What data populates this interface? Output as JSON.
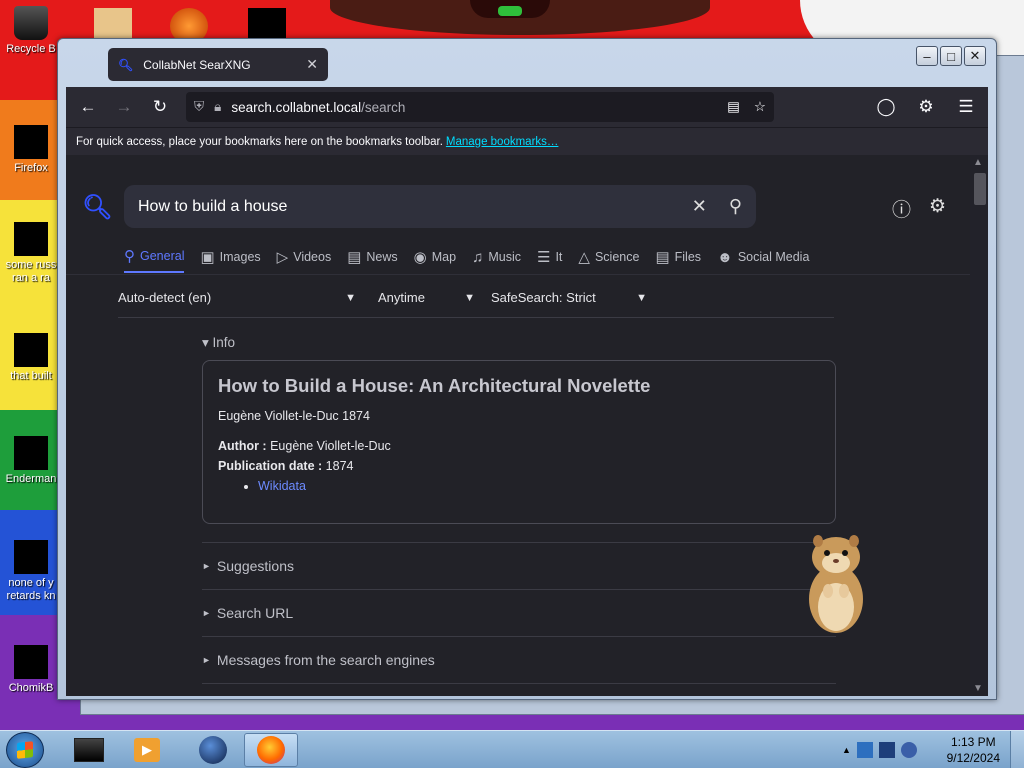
{
  "desktop": {
    "icons": [
      {
        "label": "Recycle B"
      },
      {
        "label": "Firefox"
      },
      {
        "label": "some russ\nran a ra"
      },
      {
        "label": "that built"
      },
      {
        "label": "Enderman"
      },
      {
        "label": "none of y\nretards kn"
      },
      {
        "label": "ChomikB"
      }
    ]
  },
  "window": {
    "tab": {
      "title": "CollabNet SearXNG"
    },
    "controls": {
      "minimize": "–",
      "maximize": "□",
      "close": "✕"
    }
  },
  "navbar": {
    "url_host": "search.collabnet.local",
    "url_path": "/search"
  },
  "bookmarks_bar": {
    "message": "For quick access, place your bookmarks here on the bookmarks toolbar.",
    "link": "Manage bookmarks…"
  },
  "search": {
    "query": "How to build a house"
  },
  "categories": [
    {
      "label": "General",
      "icon": "search-icon",
      "active": true
    },
    {
      "label": "Images",
      "icon": "image-icon"
    },
    {
      "label": "Videos",
      "icon": "play-icon"
    },
    {
      "label": "News",
      "icon": "newspaper-icon"
    },
    {
      "label": "Map",
      "icon": "map-pin-icon"
    },
    {
      "label": "Music",
      "icon": "music-icon"
    },
    {
      "label": "It",
      "icon": "layers-icon"
    },
    {
      "label": "Science",
      "icon": "box-icon"
    },
    {
      "label": "Files",
      "icon": "drive-icon"
    },
    {
      "label": "Social Media",
      "icon": "people-icon"
    }
  ],
  "filters": {
    "language": "Auto-detect (en)",
    "time": "Anytime",
    "safesearch": "SafeSearch: Strict"
  },
  "infobox": {
    "section_title": "Info",
    "title": "How to Build a House: An Architectural Novelette",
    "subtitle": "Eugène Viollet-le-Duc 1874",
    "author_label": "Author :",
    "author_value": "Eugène Viollet-le-Duc",
    "pubdate_label": "Publication date :",
    "pubdate_value": "1874",
    "links": [
      "Wikidata"
    ]
  },
  "sections": {
    "suggestions": "Suggestions",
    "search_url": "Search URL",
    "messages": "Messages from the search engines"
  },
  "taskbar": {
    "time": "1:13 PM",
    "date": "9/12/2024"
  },
  "colors": {
    "accent": "#5e78ff",
    "link": "#6d8bff",
    "page_bg": "#222228"
  }
}
